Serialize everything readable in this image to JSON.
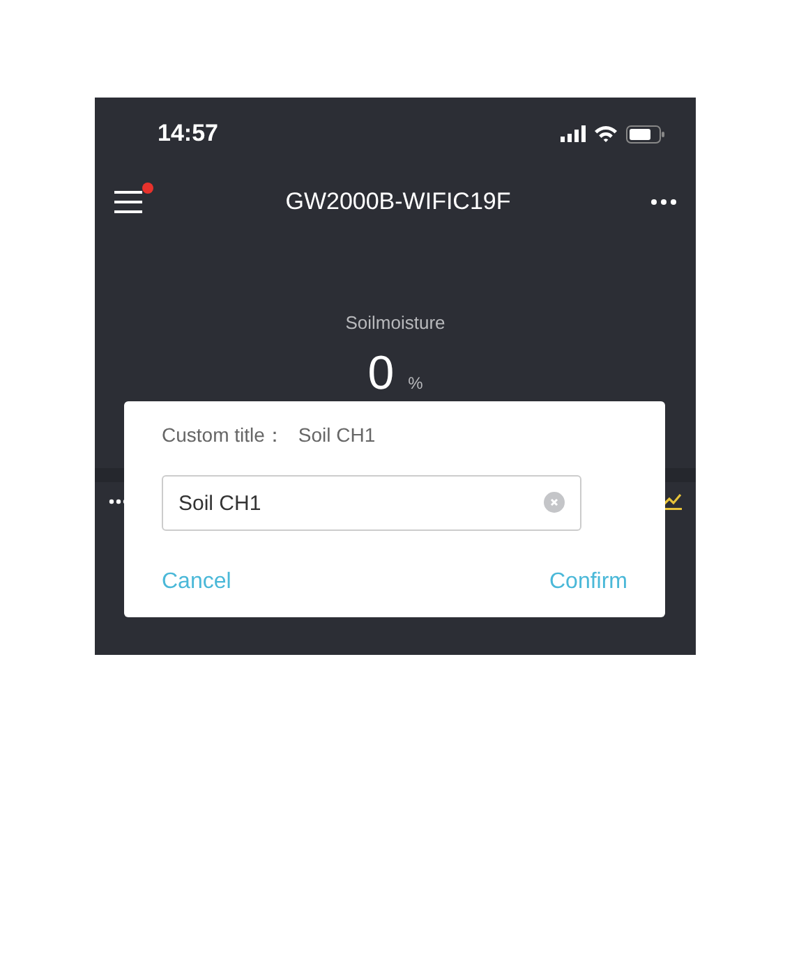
{
  "status_bar": {
    "time": "14:57"
  },
  "header": {
    "title": "GW2000B-WIFIC19F",
    "menu_badge": true
  },
  "reading": {
    "label": "Soilmoisture",
    "value": "0",
    "unit": "%"
  },
  "dialog": {
    "title": "Custom title：",
    "current": "Soil CH1",
    "field": {
      "value": "Soil CH1"
    },
    "buttons": [
      {
        "kind": "cancel",
        "label": "Cancel"
      },
      {
        "kind": "confirm",
        "label": "Confirm"
      }
    ]
  }
}
